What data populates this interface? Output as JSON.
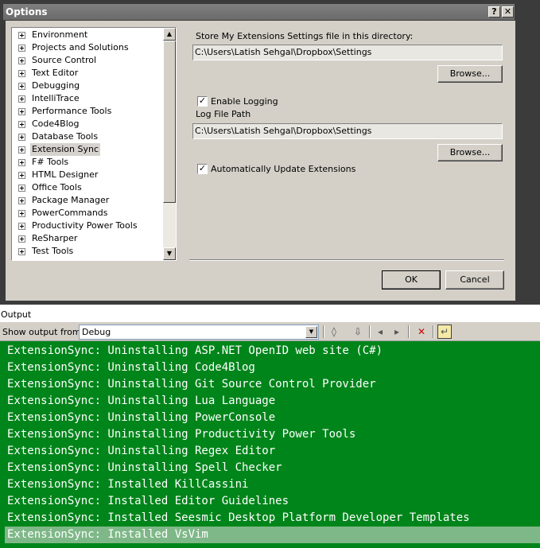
{
  "dialog": {
    "title": "Options",
    "help_glyph": "?",
    "close_glyph": "✕",
    "tree": [
      {
        "label": "Environment"
      },
      {
        "label": "Projects and Solutions"
      },
      {
        "label": "Source Control"
      },
      {
        "label": "Text Editor"
      },
      {
        "label": "Debugging"
      },
      {
        "label": "IntelliTrace"
      },
      {
        "label": "Performance Tools"
      },
      {
        "label": "Code4Blog"
      },
      {
        "label": "Database Tools"
      },
      {
        "label": "Extension Sync",
        "selected": true
      },
      {
        "label": "F# Tools"
      },
      {
        "label": "HTML Designer"
      },
      {
        "label": "Office Tools"
      },
      {
        "label": "Package Manager"
      },
      {
        "label": "PowerCommands"
      },
      {
        "label": "Productivity Power Tools"
      },
      {
        "label": "ReSharper"
      },
      {
        "label": "Test Tools"
      }
    ],
    "settings_dir_label": "Store My Extensions Settings file in this directory:",
    "settings_dir_value": "C:\\Users\\Latish Sehgal\\Dropbox\\Settings",
    "browse_label": "Browse...",
    "enable_logging_label": "Enable Logging",
    "enable_logging_checked": "✓",
    "log_path_label": "Log File Path",
    "log_path_value": "C:\\Users\\Latish Sehgal\\Dropbox\\Settings",
    "browse2_label": "Browse...",
    "auto_update_label": "Automatically Update Extensions",
    "auto_update_checked": "✓",
    "ok_label": "OK",
    "cancel_label": "Cancel"
  },
  "output": {
    "title": "Output",
    "show_from_label": "Show output from:",
    "source_value": "Debug",
    "lines": [
      "ExtensionSync: Uninstalling ASP.NET OpenID web site (C#)",
      "ExtensionSync: Uninstalling Code4Blog",
      "ExtensionSync: Uninstalling Git Source Control Provider",
      "ExtensionSync: Uninstalling Lua Language",
      "ExtensionSync: Uninstalling PowerConsole",
      "ExtensionSync: Uninstalling Productivity Power Tools",
      "ExtensionSync: Uninstalling Regex Editor",
      "ExtensionSync: Uninstalling Spell Checker",
      "ExtensionSync: Installed KillCassini",
      "ExtensionSync: Installed Editor Guidelines",
      "ExtensionSync: Installed Seesmic Desktop Platform Developer Templates",
      "ExtensionSync: Installed VsVim"
    ],
    "highlighted_line_index": 11
  },
  "colors": {
    "output_background": "#00851a",
    "output_text": "#ffffff",
    "dialog_face": "#d4d0c8"
  }
}
